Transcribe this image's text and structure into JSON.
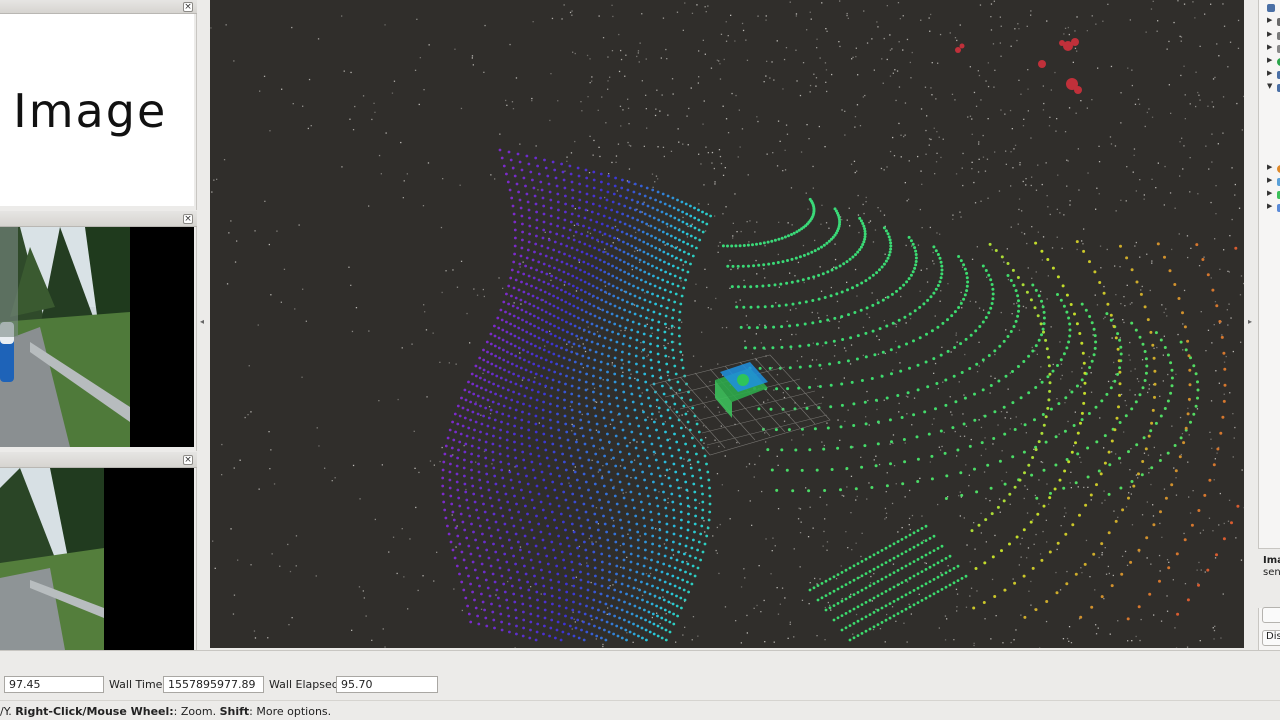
{
  "image_panels": [
    {
      "name": "image-panel-no-image",
      "placeholder_text": "No Image"
    },
    {
      "name": "camera-panel-1"
    },
    {
      "name": "camera-panel-2"
    }
  ],
  "time": {
    "ros_elapsed_value": "97.45",
    "wall_time_label": "Wall Time:",
    "wall_time_value": "1557895977.89",
    "wall_elapsed_label": "Wall Elapsed:",
    "wall_elapsed_value": "95.70"
  },
  "status": {
    "prefix": "/Y. ",
    "right_click_label": "Right-Click/Mouse Wheel:",
    "right_click_text": ": Zoom. ",
    "shift_label": "Shift",
    "shift_text": ": More options."
  },
  "right_dock": {
    "desc_title": "Image",
    "desc_text": "sensor",
    "button_label": "",
    "discard_label": "Discard"
  },
  "colors": {
    "viewport_bg": "#302e2b",
    "accent_green": "#38d66a",
    "accent_purple": "#8a2be2"
  }
}
